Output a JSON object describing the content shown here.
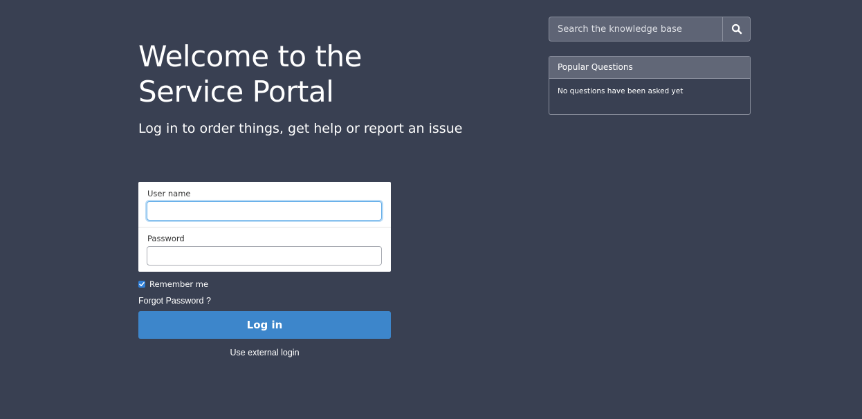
{
  "welcome": {
    "title_line1": "Welcome to the",
    "title_line2": "Service Portal",
    "subtitle": "Log in to order things, get help or report an issue"
  },
  "login": {
    "username_label": "User name",
    "username_value": "",
    "password_label": "Password",
    "password_value": "",
    "remember_label": "Remember me",
    "remember_checked": true,
    "forgot_label": "Forgot Password ?",
    "login_button_label": "Log in",
    "external_login_label": "Use external login"
  },
  "search": {
    "placeholder": "Search the knowledge base",
    "icon": "search-icon"
  },
  "popular_questions": {
    "title": "Popular Questions",
    "empty_text": "No questions have been asked yet"
  },
  "colors": {
    "background": "#394052",
    "accent": "#3d86cb",
    "panel_header": "#616777"
  }
}
